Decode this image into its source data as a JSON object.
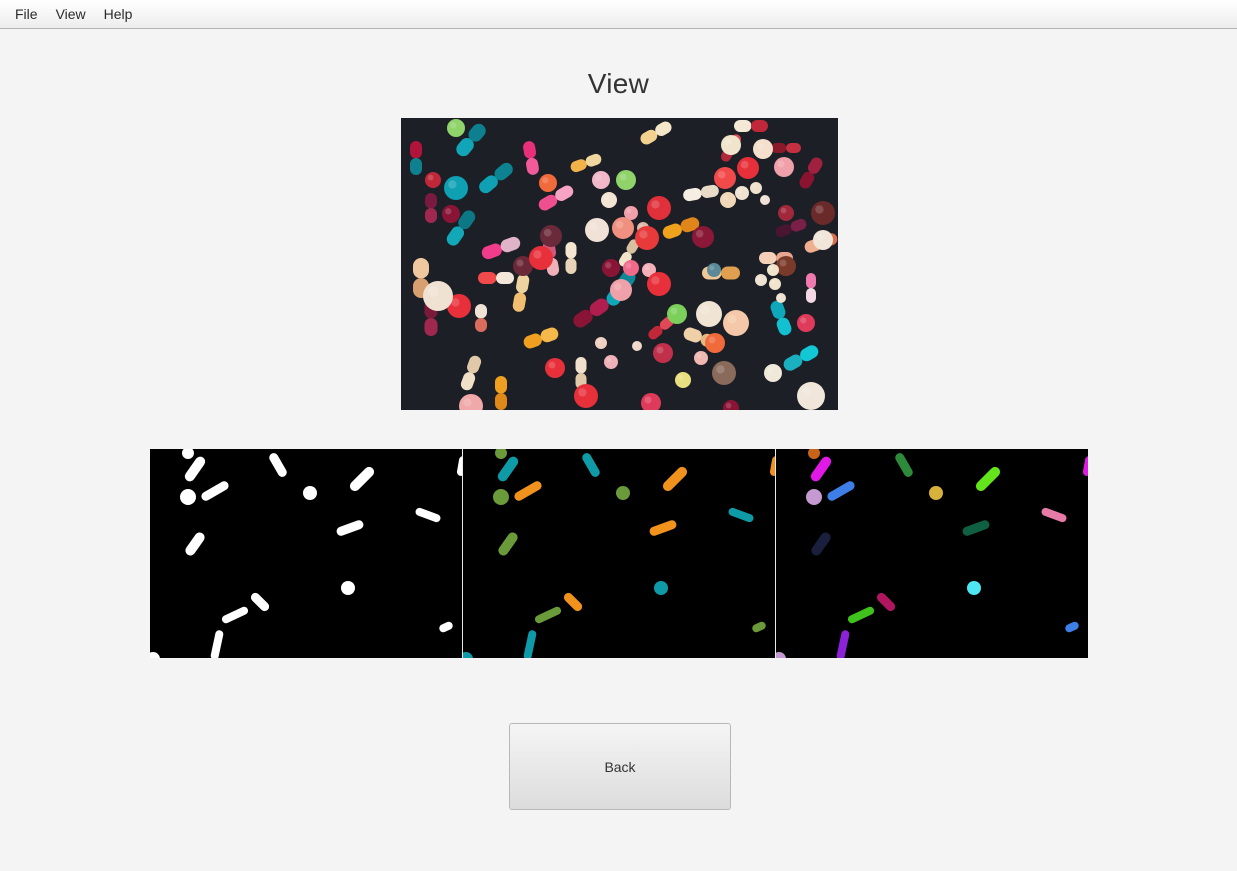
{
  "menu": {
    "items": [
      {
        "label": "File"
      },
      {
        "label": "View"
      },
      {
        "label": "Help"
      }
    ]
  },
  "page": {
    "title": "View"
  },
  "images": {
    "photo": {
      "description": "pills-photo"
    },
    "masks": [
      {
        "name": "binary-mask",
        "colors": [
          "#ffffff"
        ]
      },
      {
        "name": "cluster-mask",
        "colors": [
          "#0e9aa7",
          "#6a9a3a",
          "#f0921c"
        ]
      },
      {
        "name": "label-mask",
        "colors": [
          "#e019e6",
          "#c49ad0",
          "#3d7ee8",
          "#2d8a3a",
          "#d6b23a",
          "#63e41b",
          "#e87aa8",
          "#1a1f3e",
          "#0f6040",
          "#4ee6f0",
          "#3fc21b",
          "#b01560",
          "#8c22d8",
          "#c7641a"
        ]
      }
    ]
  },
  "actions": {
    "back_label": "Back"
  },
  "colors": {
    "background": "#f4f4f4",
    "button_gradient_top": "#f5f5f5",
    "button_gradient_bottom": "#dcdcdc"
  }
}
